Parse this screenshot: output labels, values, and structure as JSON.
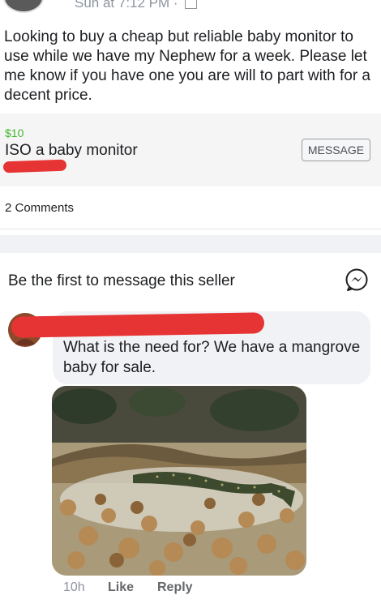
{
  "post": {
    "timestamp": "Sun at 7:12 PM ·",
    "text": "Looking to buy a cheap but reliable baby monitor to use while we have my Nephew for a week. Please let me know if you have one you are will to part with for a decent price."
  },
  "listing": {
    "price": "$10",
    "title": "ISO a baby monitor",
    "message_button": "MESSAGE"
  },
  "comments_count": "2 Comments",
  "first_message_prompt": "Be the first to message this seller",
  "comment": {
    "text": "What is the need for? We have a mangrove baby for sale.",
    "time": "10h",
    "like": "Like",
    "reply": "Reply"
  },
  "colors": {
    "price": "#42b72a",
    "redaction": "#e63333",
    "messenger": "#1c1e21"
  },
  "icons": [
    "image-icon",
    "messenger-icon"
  ]
}
